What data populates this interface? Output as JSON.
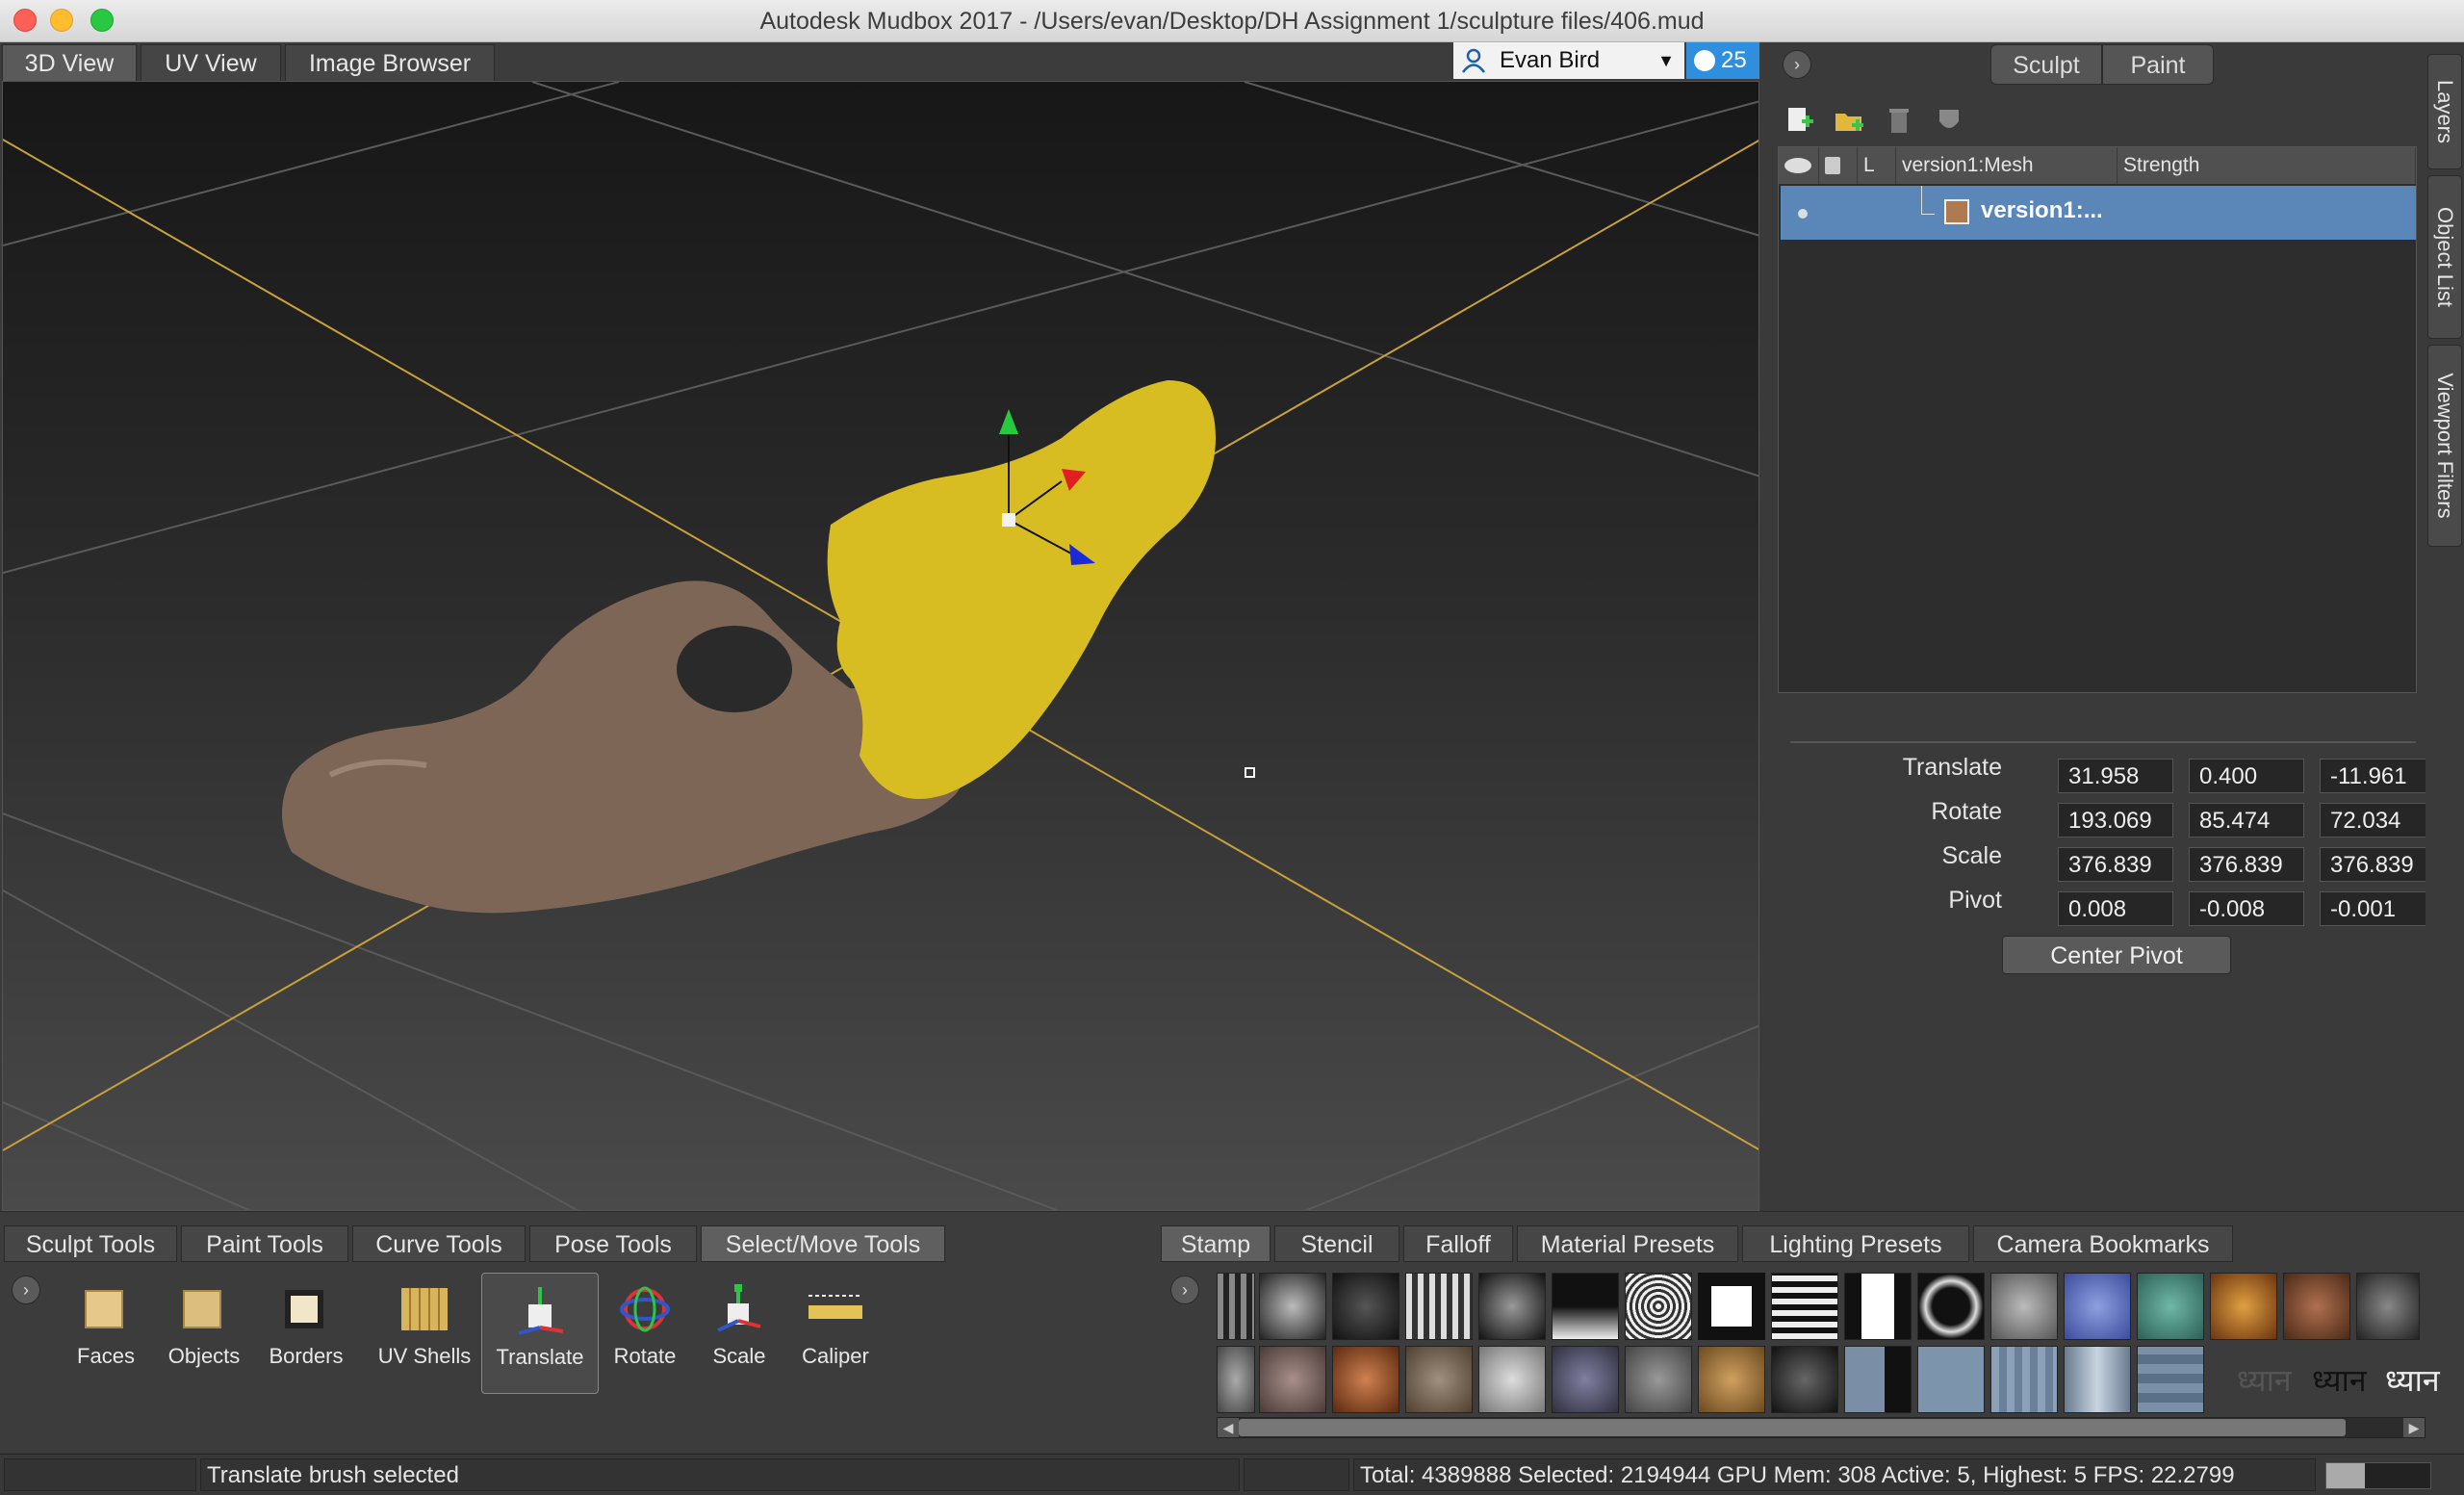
{
  "window": {
    "title": "Autodesk Mudbox 2017 - /Users/evan/Desktop/DH Assignment 1/sculpture files/406.mud"
  },
  "view_tabs": [
    "3D View",
    "UV View",
    "Image Browser"
  ],
  "user": {
    "name": "Evan Bird",
    "notifications": "25"
  },
  "mode_tabs": [
    "Sculpt",
    "Paint"
  ],
  "side_tabs": [
    "Layers",
    "Object List",
    "Viewport Filters"
  ],
  "layers": {
    "columns": [
      "L",
      "version1:Mesh",
      "Strength"
    ],
    "rows": [
      {
        "name": "version1:..."
      }
    ]
  },
  "properties": {
    "rows": [
      {
        "label": "Translate",
        "values": [
          "31.958",
          "0.400",
          "-11.961"
        ]
      },
      {
        "label": "Rotate",
        "values": [
          "193.069",
          "85.474",
          "72.034"
        ]
      },
      {
        "label": "Scale",
        "values": [
          "376.839",
          "376.839",
          "376.839"
        ]
      },
      {
        "label": "Pivot",
        "values": [
          "0.008",
          "-0.008",
          "-0.001"
        ]
      }
    ],
    "center_pivot_label": "Center Pivot"
  },
  "tool_tabs": [
    "Sculpt Tools",
    "Paint Tools",
    "Curve Tools",
    "Pose Tools",
    "Select/Move Tools"
  ],
  "tools": [
    {
      "label": "Faces",
      "icon": "faces-icon"
    },
    {
      "label": "Objects",
      "icon": "objects-icon"
    },
    {
      "label": "Borders",
      "icon": "borders-icon"
    },
    {
      "label": "UV Shells",
      "icon": "uv-shells-icon"
    },
    {
      "label": "Translate",
      "icon": "translate-icon"
    },
    {
      "label": "Rotate",
      "icon": "rotate-icon"
    },
    {
      "label": "Scale",
      "icon": "scale-icon"
    },
    {
      "label": "Caliper",
      "icon": "caliper-icon"
    }
  ],
  "tray_tabs": [
    "Stamp",
    "Stencil",
    "Falloff",
    "Material Presets",
    "Lighting Presets",
    "Camera Bookmarks"
  ],
  "stamp_text": [
    "ध्यान",
    "ध्यान",
    "ध्यान"
  ],
  "status": {
    "message": "Translate brush selected",
    "stats": "Total: 4389888  Selected: 2194944 GPU Mem: 308  Active: 5, Highest: 5  FPS: 22.2799"
  },
  "colors": {
    "accent": "#2f8fdc",
    "selection": "#5b86b8",
    "grid_axis": "#c9a13a",
    "mesh_brown": "#7d6656",
    "mesh_yellow": "#d8bd22"
  }
}
